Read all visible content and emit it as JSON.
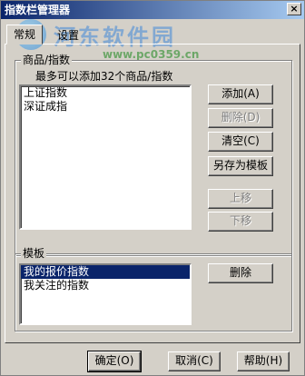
{
  "window": {
    "title": "指数栏管理器",
    "close_glyph": "×"
  },
  "watermark": {
    "title": "河东软件园",
    "url": "www.pc0359.cn"
  },
  "tabs": [
    {
      "label": "常规"
    },
    {
      "label": "设置"
    }
  ],
  "products_group": {
    "label": "商品/指数",
    "hint": "最多可以添加32个商品/指数",
    "items": [
      "上证指数",
      "深证成指"
    ],
    "buttons": {
      "add": "添加(A)",
      "delete": "删除(D)",
      "clear": "清空(C)",
      "save_template": "另存为模板",
      "move_up": "上移",
      "move_down": "下移"
    }
  },
  "template_group": {
    "label": "模板",
    "items": [
      "我的报价指数",
      "我关注的指数"
    ],
    "selected_index": 0,
    "buttons": {
      "delete": "删除"
    }
  },
  "footer": {
    "ok": "确定(O)",
    "cancel": "取消(C)",
    "help": "帮助(H)"
  }
}
